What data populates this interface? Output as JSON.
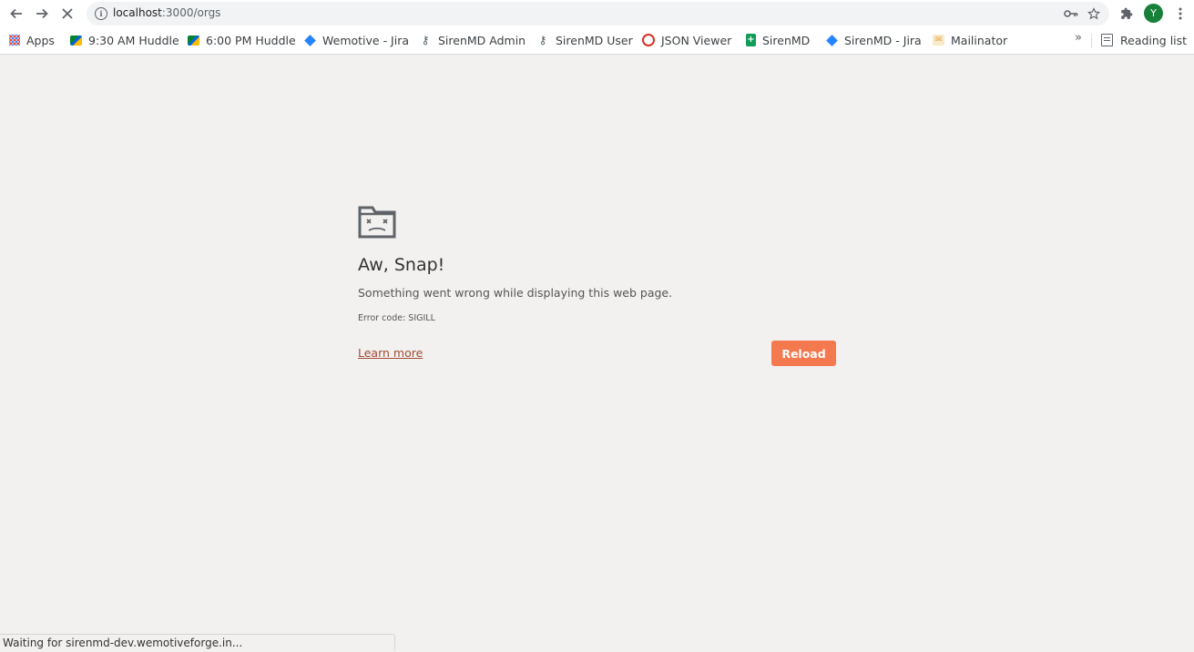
{
  "toolbar": {
    "url_host": "localhost",
    "url_path": ":3000/orgs",
    "avatar_initial": "Y"
  },
  "bookmarks": [
    {
      "label": "Apps",
      "icon": "apps-grid-icon"
    },
    {
      "label": "9:30 AM Huddle",
      "icon": "google-meet-icon"
    },
    {
      "label": "6:00 PM Huddle",
      "icon": "google-meet-icon"
    },
    {
      "label": "Wemotive - Jira",
      "icon": "jira-icon"
    },
    {
      "label": "SirenMD Admin",
      "icon": "admin-icon"
    },
    {
      "label": "SirenMD User",
      "icon": "admin-icon"
    },
    {
      "label": "JSON Viewer",
      "icon": "json-viewer-icon"
    },
    {
      "label": "SirenMD",
      "icon": "google-sheets-icon"
    },
    {
      "label": "SirenMD - Jira",
      "icon": "jira-icon"
    },
    {
      "label": "Mailinator",
      "icon": "mailinator-icon"
    }
  ],
  "reading_list": "Reading list",
  "error_page": {
    "title": "Aw, Snap!",
    "description": "Something went wrong while displaying this web page.",
    "error_code": "Error code: SIGILL",
    "learn_more": "Learn more",
    "reload": "Reload"
  },
  "status": "Waiting for sirenmd-dev.wemotiveforge.in..."
}
